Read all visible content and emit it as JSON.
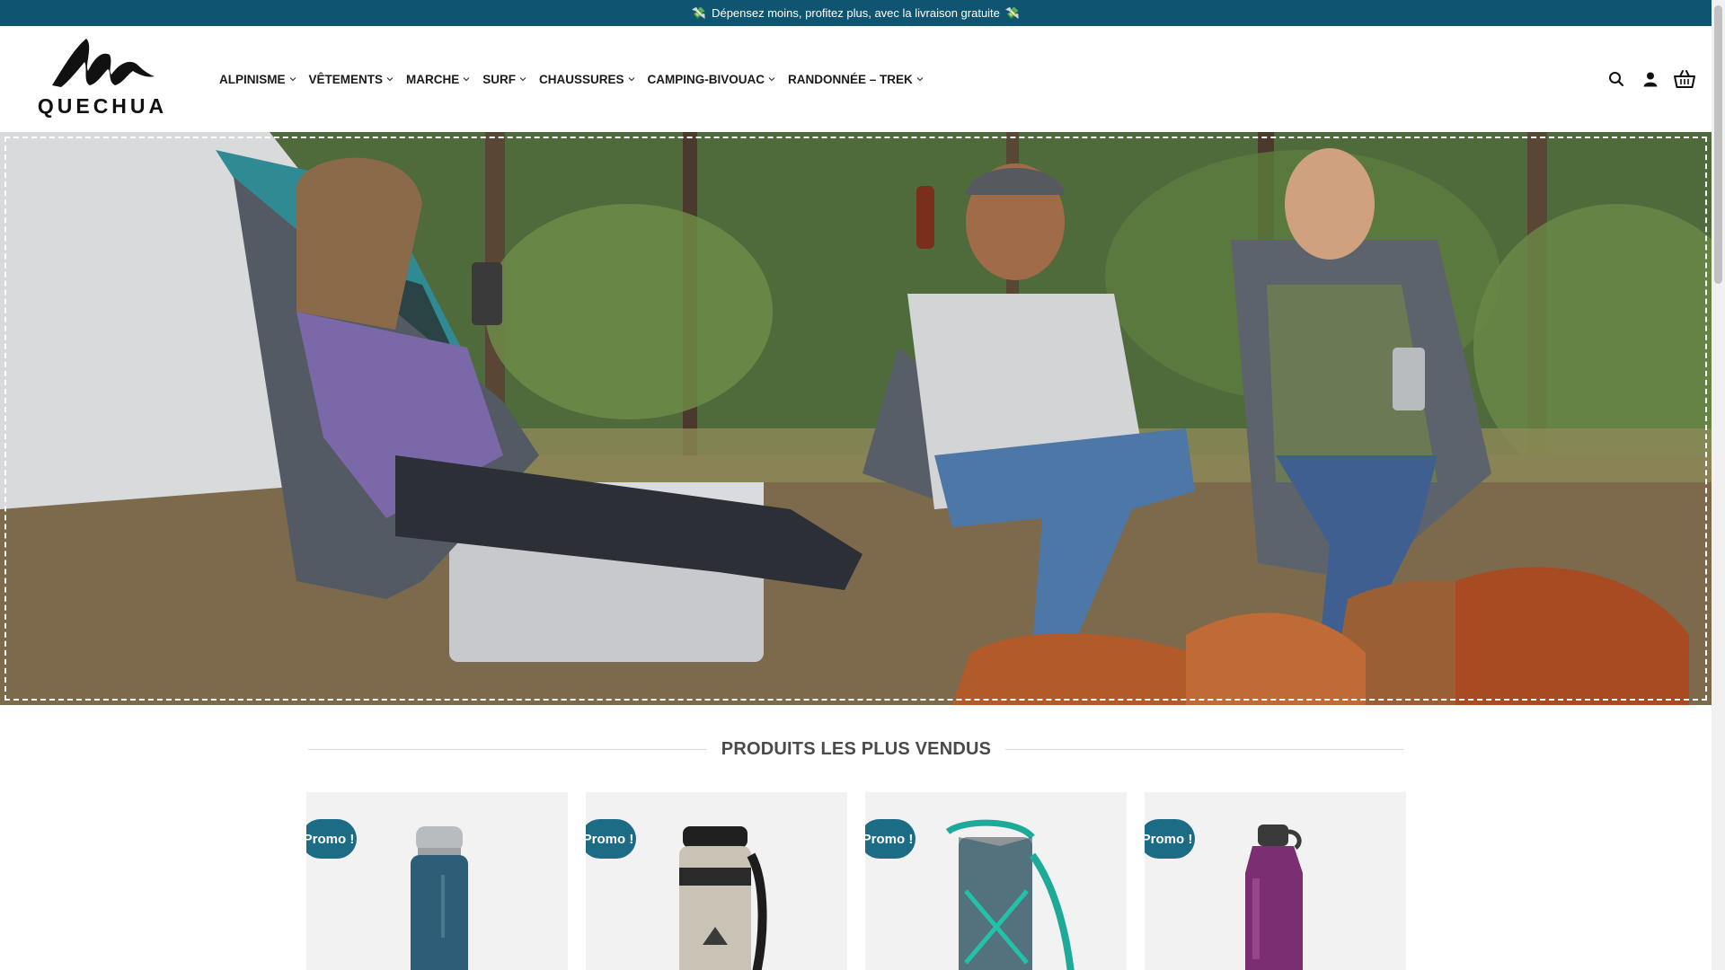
{
  "topbar": {
    "icon_left": "money-wings",
    "message": "Dépensez moins, profitez plus, avec la livraison gratuite",
    "icon_right": "money-wings",
    "background": "#0f5470"
  },
  "brand": {
    "name": "QUECHUA"
  },
  "nav": {
    "items": [
      {
        "label": "ALPINISME"
      },
      {
        "label": "VÊTEMENTS"
      },
      {
        "label": "MARCHE"
      },
      {
        "label": "SURF"
      },
      {
        "label": "CHAUSSURES"
      },
      {
        "label": "CAMPING-BIVOUAC"
      },
      {
        "label": "RANDONNÉE – TREK"
      }
    ]
  },
  "header_icons": [
    "search-icon",
    "user-icon",
    "basket-icon"
  ],
  "section": {
    "title": "PRODUITS LES PLUS VENDUS"
  },
  "products": [
    {
      "badge": "Promo !",
      "image": "blue-steel-thermos"
    },
    {
      "badge": "Promo !",
      "image": "steel-vacuum-flask-with-strap"
    },
    {
      "badge": "Promo !",
      "image": "insulated-bottle-cover-with-strap"
    },
    {
      "badge": "Promo !",
      "image": "purple-water-bottle"
    }
  ],
  "colors": {
    "accent": "#1d6c86",
    "topbar": "#0f5470"
  }
}
